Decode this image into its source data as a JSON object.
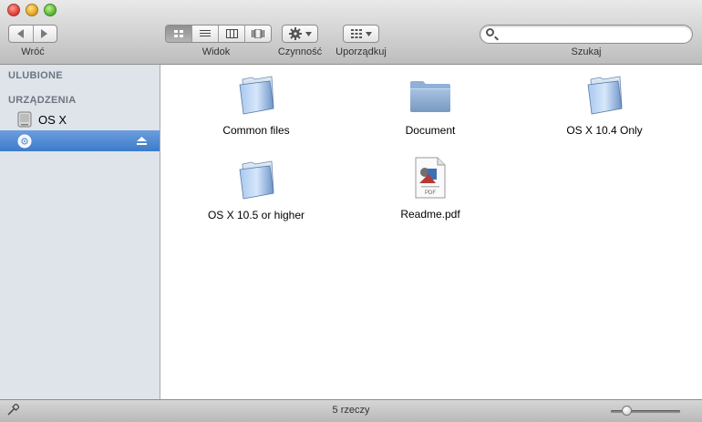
{
  "toolbar": {
    "back_label": "Wróć",
    "view_label": "Widok",
    "actions_label": "Czynność",
    "arrange_label": "Uporządkuj",
    "search_label": "Szukaj",
    "search_value": ""
  },
  "sidebar": {
    "favorites_header": "ULUBIONE",
    "devices_header": "URZĄDZENIA",
    "devices": [
      {
        "label": "OS X",
        "icon": "hard-drive-icon",
        "selected": false
      },
      {
        "label": "",
        "icon": "disc-icon",
        "selected": true,
        "eject_icon": "eject-icon"
      }
    ]
  },
  "files": [
    {
      "name": "Common files",
      "icon": "folder-icon"
    },
    {
      "name": "Document",
      "icon": "folder-icon"
    },
    {
      "name": "OS X 10.4 Only",
      "icon": "folder-icon"
    },
    {
      "name": "OS X 10.5 or higher",
      "icon": "folder-icon"
    },
    {
      "name": "Readme.pdf",
      "icon": "pdf-file-icon"
    }
  ],
  "status": {
    "item_count": "5 rzeczy",
    "zoom_level": 0.18
  },
  "colors": {
    "selection": "#3d7bc9",
    "sidebar_bg": "#dfe4ea",
    "folder_blue": "#7fa8d6"
  }
}
